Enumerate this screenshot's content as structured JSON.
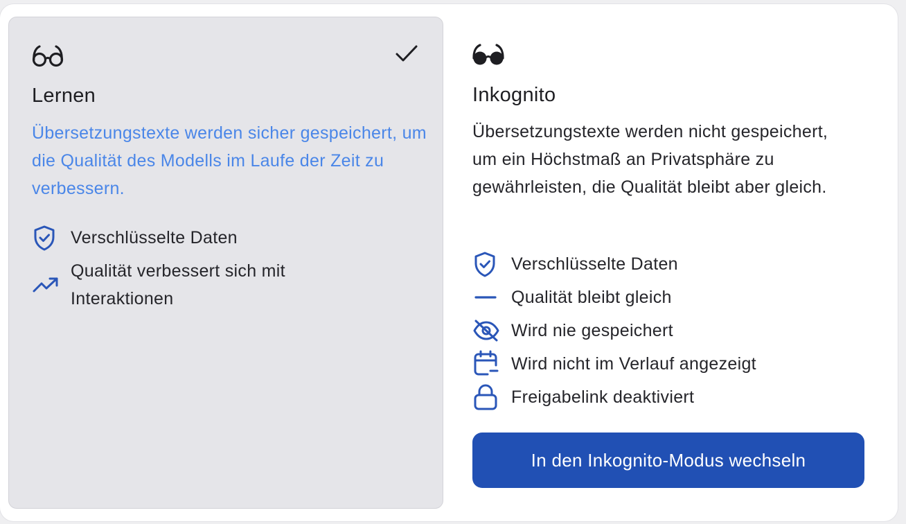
{
  "learn": {
    "icon": "glasses-outline-icon",
    "selected_icon": "checkmark-icon",
    "title": "Lernen",
    "description": "Übersetzungstexte werden sicher gespeichert, um die Qualität des Modells im Laufe der Zeit zu verbessern.",
    "description_color": "#4a86e8",
    "features": [
      {
        "icon": "shield-check-icon",
        "label": "Verschlüsselte Daten"
      },
      {
        "icon": "trending-up-icon",
        "label": "Qualität verbessert sich mit Interaktionen"
      }
    ]
  },
  "incognito": {
    "icon": "glasses-filled-icon",
    "title": "Inkognito",
    "description": "Übersetzungstexte werden nicht gespeichert, um ein Höchstmaß an Privatsphäre zu gewährleisten, die Qualität bleibt aber gleich.",
    "features": [
      {
        "icon": "shield-check-icon",
        "label": "Verschlüsselte Daten"
      },
      {
        "icon": "minus-icon",
        "label": "Qualität bleibt gleich"
      },
      {
        "icon": "eye-off-icon",
        "label": "Wird nie gespeichert"
      },
      {
        "icon": "calendar-minus-icon",
        "label": "Wird nicht im Verlauf angezeigt"
      },
      {
        "icon": "lock-icon",
        "label": "Freigabelink deaktiviert"
      }
    ],
    "button_label": "In den Inkognito-Modus wechseln"
  },
  "colors": {
    "accent": "#2150b4",
    "icon_blue": "#2a56b8",
    "selected_card_bg": "#e5e5e9",
    "text": "#25252a"
  }
}
